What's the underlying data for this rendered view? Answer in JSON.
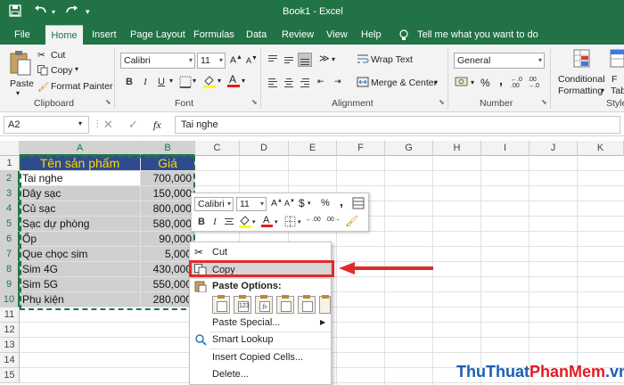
{
  "window": {
    "title": "Book1 - Excel",
    "tell_me": "Tell me what you want to do",
    "accent": "#217346"
  },
  "tabs": [
    "File",
    "Home",
    "Insert",
    "Page Layout",
    "Formulas",
    "Data",
    "Review",
    "View",
    "Help"
  ],
  "ribbon": {
    "clipboard": {
      "paste": "Paste",
      "cut": "Cut",
      "copy": "Copy",
      "format_painter": "Format Painter",
      "label": "Clipboard"
    },
    "font": {
      "name": "Calibri",
      "size": "11",
      "label": "Font"
    },
    "alignment": {
      "wrap_text": "Wrap Text",
      "merge_center": "Merge & Center",
      "label": "Alignment"
    },
    "number": {
      "format": "General",
      "label": "Number"
    },
    "styles": {
      "conditional": "Conditional",
      "formatting": "Formatting",
      "table_frag": "Tab",
      "label": "Styles"
    }
  },
  "formula_bar": {
    "name_box": "A2",
    "fx": "fx",
    "value": "Tai nghe"
  },
  "grid": {
    "columns": [
      "A",
      "B",
      "C",
      "D",
      "E",
      "F",
      "G",
      "H",
      "I",
      "J",
      "K"
    ],
    "rows": [
      "1",
      "2",
      "3",
      "4",
      "5",
      "6",
      "7",
      "8",
      "9",
      "10",
      "11",
      "12",
      "13",
      "14",
      "15"
    ],
    "header": [
      "Tên sản phẩm",
      "Giá"
    ],
    "data": [
      [
        "Tai nghe",
        "700,000"
      ],
      [
        "Dây sạc",
        "150,000"
      ],
      [
        "Củ sạc",
        "800,000"
      ],
      [
        "Sạc dự phòng",
        "580,000"
      ],
      [
        "Ốp",
        "90,000"
      ],
      [
        "Que chọc sim",
        "5,000"
      ],
      [
        "Sim 4G",
        "430,000"
      ],
      [
        "Sim 5G",
        "550,000"
      ],
      [
        "Phụ kiện",
        "280,000"
      ]
    ]
  },
  "mini_toolbar": {
    "font": "Calibri",
    "size": "11",
    "currency": "$",
    "percent": "%",
    "comma": ","
  },
  "context_menu": {
    "items": {
      "cut": "Cut",
      "copy": "Copy",
      "paste_options": "Paste Options:",
      "paste_special": "Paste Special...",
      "smart_lookup": "Smart Lookup",
      "insert_copied": "Insert Copied Cells...",
      "delete": "Delete..."
    },
    "paste_icons": [
      "paste",
      "values",
      "formulas",
      "transpose",
      "formatting",
      "paste-link"
    ],
    "paste_icon_labels": [
      "",
      "123",
      "fx",
      "",
      "",
      ""
    ]
  },
  "watermark": {
    "text": "ThuThuatPhanMem.vn",
    "part1": "ThuThuat",
    "part2": "PhanMem",
    "part3": ".vn"
  }
}
